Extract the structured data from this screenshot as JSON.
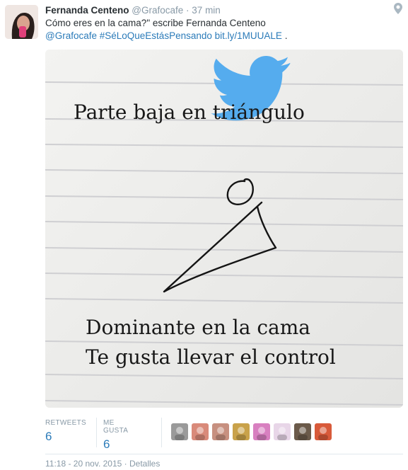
{
  "tweet": {
    "author_name": "Fernanda Centeno",
    "author_handle": "@Grafocafe",
    "separator": "·",
    "time_ago": "37 min",
    "text_line1": "Cómo eres en la cama?\" escribe Fernanda Centeno",
    "mention": "@Grafocafe",
    "hashtag": "#SéLoQueEstásPensando",
    "link": "bit.ly/1MUUALE",
    "trailing": "."
  },
  "media": {
    "caption_top": "Parte baja en triángulo",
    "caption_bottom_1": "Dominante en la cama",
    "caption_bottom_2": "Te gusta llevar el control",
    "logo": "twitter-bird-icon",
    "logo_color": "#55acee"
  },
  "stats": {
    "retweets_label": "RETWEETS",
    "retweets_value": "6",
    "likes_label": "ME GUSTA",
    "likes_value": "6"
  },
  "likers": [
    {
      "name": "liker-avatar-1",
      "color": "#9a9a9a"
    },
    {
      "name": "liker-avatar-2",
      "color": "#d98a7a"
    },
    {
      "name": "liker-avatar-3",
      "color": "#c79080"
    },
    {
      "name": "liker-avatar-4",
      "color": "#c9a24a"
    },
    {
      "name": "liker-avatar-5",
      "color": "#d880c0"
    },
    {
      "name": "liker-avatar-6",
      "color": "#e8d6e8"
    },
    {
      "name": "liker-avatar-7",
      "color": "#6b5a4a"
    },
    {
      "name": "liker-avatar-8",
      "color": "#d85a3a"
    }
  ],
  "footer": {
    "timestamp": "11:18 - 20 nov. 2015",
    "separator": "·",
    "details": "Detalles"
  },
  "colors": {
    "link": "#2b7bb9",
    "muted": "#8899a6",
    "text": "#292f33"
  }
}
